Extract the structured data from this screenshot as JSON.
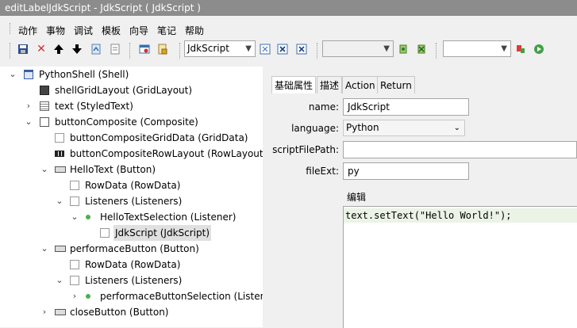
{
  "window": {
    "title": "editLabelJdkScript - JdkScript ( JdkScript )"
  },
  "menu": {
    "items": [
      "动作",
      "事物",
      "调试",
      "模板",
      "向导",
      "笔记",
      "帮助"
    ]
  },
  "toolbar": {
    "script_select": "JdkScript",
    "combo2": "",
    "combo3": "",
    "icons": [
      "save-icon",
      "delete-icon",
      "move-up-icon",
      "move-down-icon",
      "refresh-icon",
      "document-icon",
      "debug-icon",
      "lock-icon",
      "script-icon",
      "xml-icon",
      "xml-close-icon",
      "plugin-icon",
      "plugin-remove-icon",
      "stop-icon",
      "run-icon"
    ]
  },
  "tree": {
    "nodes": [
      {
        "label": "PythonShell (Shell)",
        "twisty": "v",
        "icon": "window"
      },
      {
        "label": "shellGridLayout (GridLayout)",
        "twisty": "",
        "icon": "grid"
      },
      {
        "label": "text (StyledText)",
        "twisty": ">",
        "icon": "text"
      },
      {
        "label": "buttonComposite (Composite)",
        "twisty": "v",
        "icon": "box"
      },
      {
        "label": "buttonCompositeGridData (GridData)",
        "twisty": "",
        "icon": "page"
      },
      {
        "label": "buttonCompositeRowLayout (RowLayout)",
        "twisty": "",
        "icon": "row"
      },
      {
        "label": "HelloText (Button)",
        "twisty": "v",
        "icon": "button"
      },
      {
        "label": "RowData (RowData)",
        "twisty": "",
        "icon": "page"
      },
      {
        "label": "Listeners (Listeners)",
        "twisty": "v",
        "icon": "page"
      },
      {
        "label": "HelloTextSelection (Listener)",
        "twisty": "v",
        "icon": "dot"
      },
      {
        "label": "JdkScript (JdkScript)",
        "twisty": "",
        "icon": "page",
        "selected": true
      },
      {
        "label": "performaceButton (Button)",
        "twisty": "v",
        "icon": "button"
      },
      {
        "label": "RowData (RowData)",
        "twisty": "",
        "icon": "page"
      },
      {
        "label": "Listeners (Listeners)",
        "twisty": "v",
        "icon": "page"
      },
      {
        "label": "performaceButtonSelection (Listene",
        "twisty": ">",
        "icon": "dot"
      },
      {
        "label": "closeButton (Button)",
        "twisty": ">",
        "icon": "button"
      }
    ]
  },
  "tabs": [
    {
      "label": "基础属性",
      "active": true
    },
    {
      "label": "描述"
    },
    {
      "label": "Action"
    },
    {
      "label": "Return"
    }
  ],
  "form": {
    "name_label": "name:",
    "name_value": "JdkScript",
    "language_label": "language:",
    "language_value": "Python",
    "script_path_label": "scriptFilePath:",
    "script_path_value": "",
    "file_ext_label": "fileExt:",
    "file_ext_value": "py",
    "editor_label": "编辑",
    "editor_code": "text.setText(\"Hello World!\");"
  }
}
